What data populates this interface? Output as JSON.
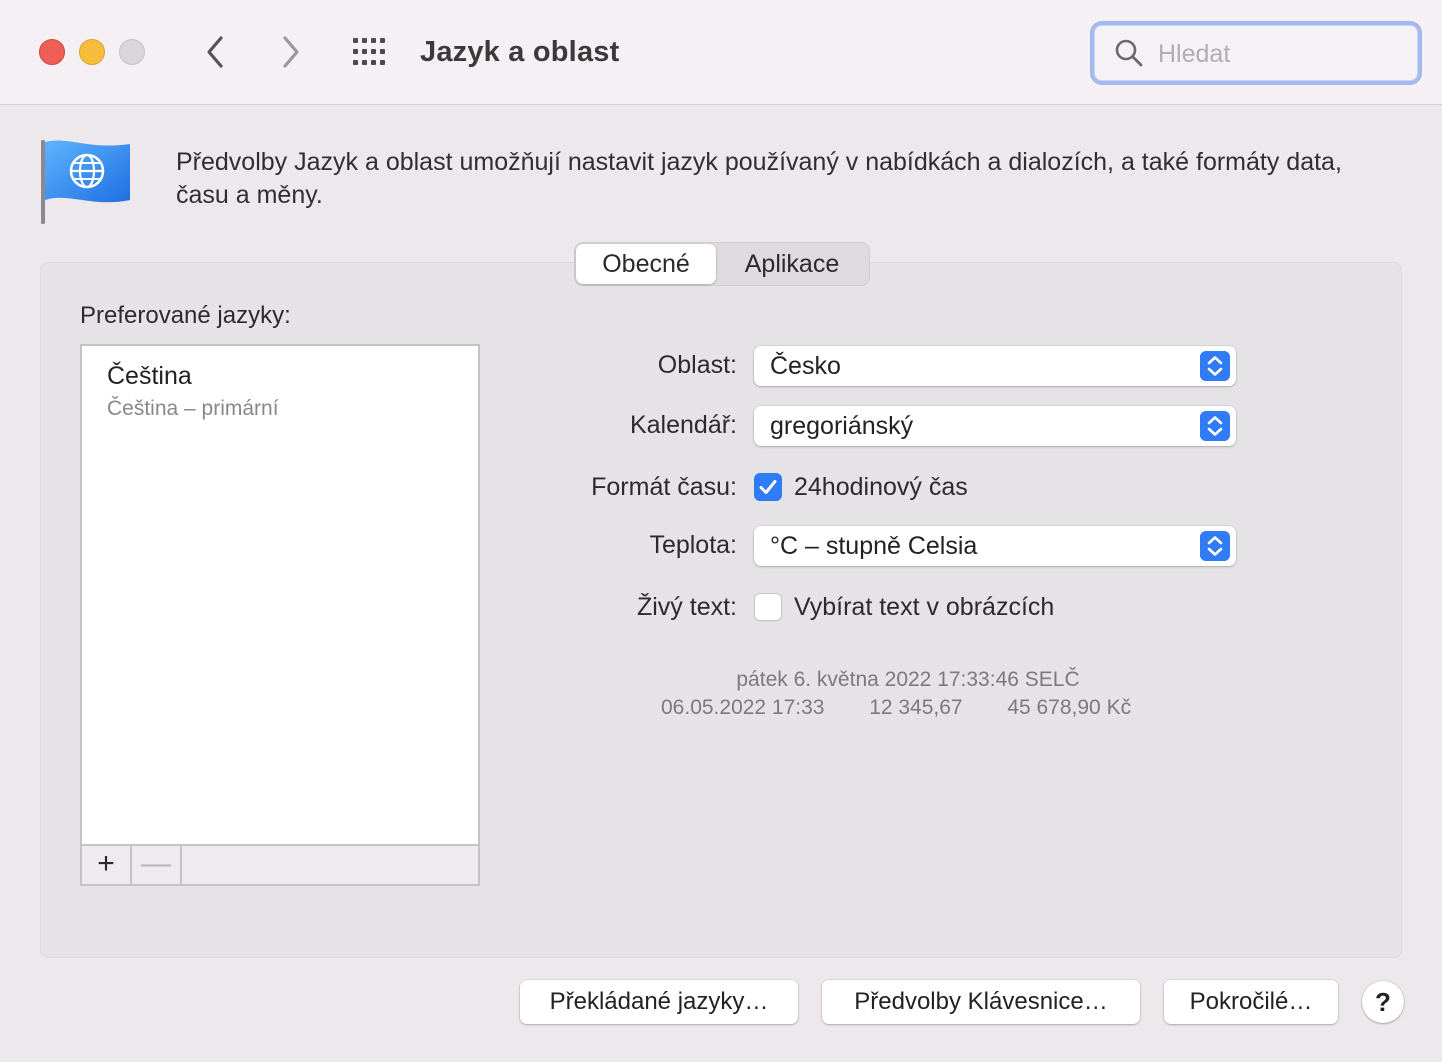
{
  "window": {
    "title": "Jazyk a oblast",
    "search": {
      "placeholder": "Hledat",
      "value": ""
    },
    "accent_color": "#2f7cf6"
  },
  "header": {
    "icon": "globe-flag-icon",
    "description": "Předvolby Jazyk a oblast umožňují nastavit jazyk používaný v nabídkách a dialozích, a také formáty data, času a měny."
  },
  "tabs": [
    {
      "label": "Obecné",
      "selected": true
    },
    {
      "label": "Aplikace",
      "selected": false
    }
  ],
  "languages": {
    "label": "Preferované jazyky:",
    "items": [
      {
        "name": "Čeština",
        "sub": "Čeština – primární"
      }
    ],
    "add_symbol": "+",
    "remove_symbol": "—"
  },
  "settings": {
    "region": {
      "label": "Oblast:",
      "value": "Česko"
    },
    "calendar": {
      "label": "Kalendář:",
      "value": "gregoriánský"
    },
    "time_format": {
      "label": "Formát času:",
      "checkbox_label": "24hodinový čas",
      "checked": true
    },
    "temperature": {
      "label": "Teplota:",
      "value": "°C – stupně Celsia"
    },
    "live_text": {
      "label": "Živý text:",
      "checkbox_label": "Vybírat text v obrázcích",
      "checked": false
    }
  },
  "sample": {
    "line1": "pátek 6. května 2022 17:33:46 SELČ",
    "datetime": "06.05.2022 17:33",
    "number": "12 345,67",
    "currency": "45 678,90 Kč"
  },
  "buttons": {
    "translated_languages": "Překládané jazyky…",
    "keyboard_prefs": "Předvolby Klávesnice…",
    "advanced": "Pokročilé…",
    "help": "?"
  }
}
